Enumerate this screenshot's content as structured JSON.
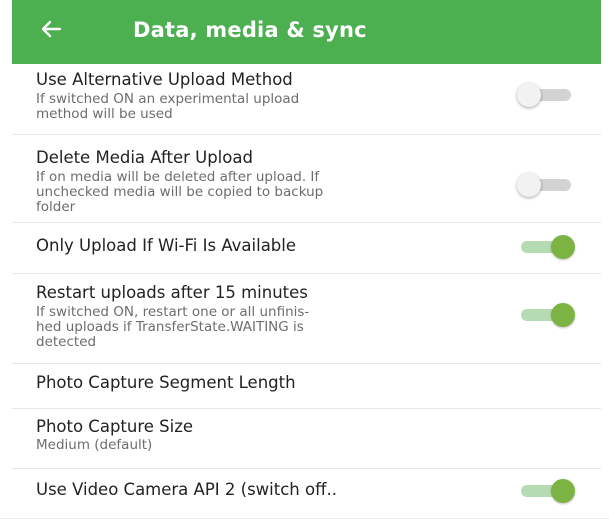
{
  "header": {
    "title": "Data, media & sync",
    "back_icon": "arrow-left-icon",
    "background_color": "#4caf50"
  },
  "settings": [
    {
      "title": "Use Alternative Upload Method",
      "subtitle": [
        "If switched ON an experimental upload",
        "method will be used"
      ],
      "switch": "off"
    },
    {
      "title": "Delete Media After Upload",
      "subtitle": [
        "If on media will be deleted after upload. If",
        "unchecked media will be copied to backup",
        "folder"
      ],
      "switch": "off"
    },
    {
      "title": "Only Upload If Wi-Fi Is Available",
      "subtitle": [],
      "switch": "on"
    },
    {
      "title": "Restart uploads after 15 minutes",
      "subtitle": [
        "If switched ON, restart one or all unfinis-",
        "hed uploads if TransferState.WAITING is",
        "detected"
      ],
      "switch": "on"
    },
    {
      "title": "Photo Capture Segment Length",
      "subtitle": [],
      "switch": null
    },
    {
      "title": "Photo Capture Size",
      "subtitle": [
        "Medium (default)"
      ],
      "switch": null
    },
    {
      "title": "Use Video Camera API 2 (switch off..",
      "subtitle": [],
      "switch": "on"
    }
  ],
  "colors": {
    "switch_on_thumb": "#7cb342",
    "switch_on_track": "#b5dbb3",
    "switch_off_thumb": "#f2f2f2",
    "switch_off_track": "#d3d3d3"
  }
}
